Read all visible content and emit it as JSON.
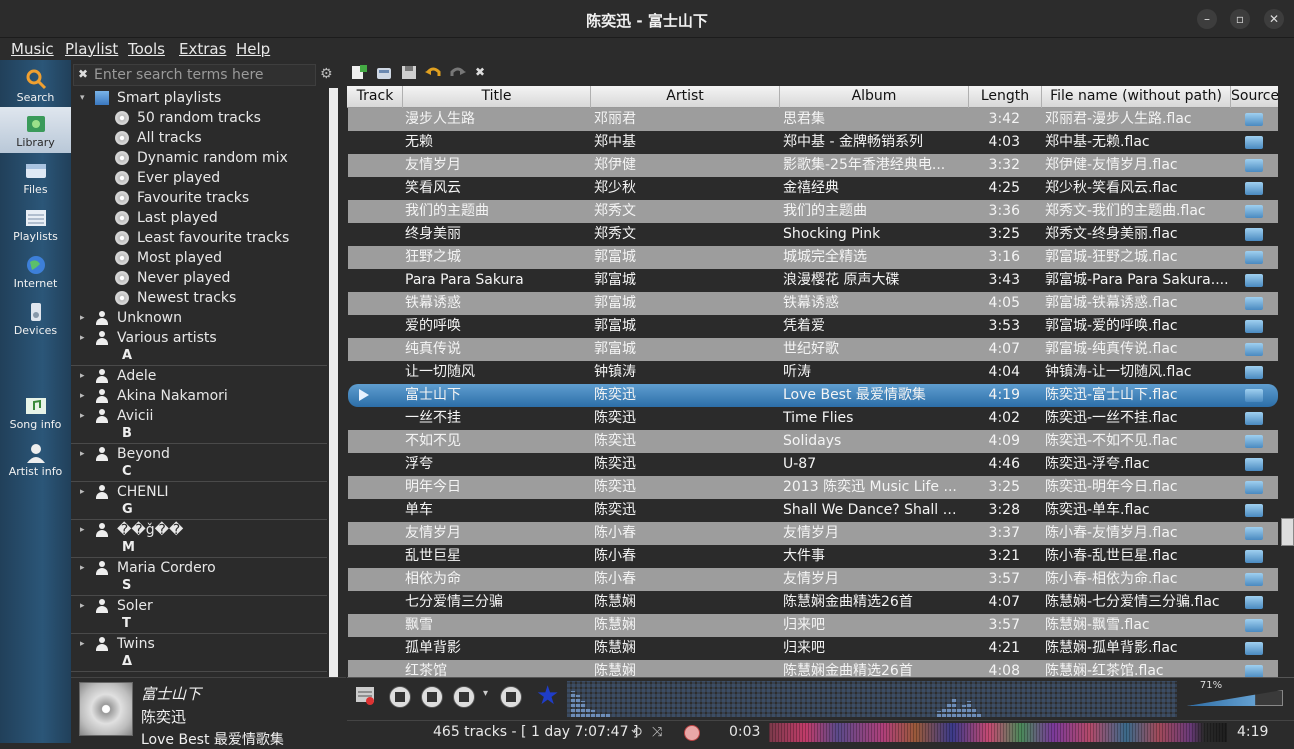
{
  "window": {
    "title": "陈奕迅 - 富士山下"
  },
  "menu": [
    "Music",
    "Playlist",
    "Tools",
    "Extras",
    "Help"
  ],
  "tabs": [
    {
      "label": "Search",
      "icon": "search-icon"
    },
    {
      "label": "Library",
      "icon": "library-icon",
      "active": true
    },
    {
      "label": "Files",
      "icon": "files-icon"
    },
    {
      "label": "Playlists",
      "icon": "playlists-icon"
    },
    {
      "label": "Internet",
      "icon": "internet-icon"
    },
    {
      "label": "Devices",
      "icon": "devices-icon"
    },
    {
      "label": "Song info",
      "icon": "song-info-icon"
    },
    {
      "label": "Artist info",
      "icon": "artist-info-icon"
    }
  ],
  "library": {
    "search_placeholder": "Enter search terms here",
    "smart_playlists_label": "Smart playlists",
    "smart_playlists": [
      "50 random tracks",
      "All tracks",
      "Dynamic random mix",
      "Ever played",
      "Favourite tracks",
      "Last played",
      "Least favourite tracks",
      "Most played",
      "Never played",
      "Newest tracks"
    ],
    "artists_top": [
      "Unknown",
      "Various artists"
    ],
    "groups": [
      {
        "divider": "A",
        "artists": [
          "Adele",
          "Akina Nakamori",
          "Avicii"
        ]
      },
      {
        "divider": "B",
        "artists": [
          "Beyond"
        ]
      },
      {
        "divider": "C",
        "artists": [
          "CHENLI"
        ]
      },
      {
        "divider": "G",
        "artists": [
          "��ǧ��"
        ]
      },
      {
        "divider": "M",
        "artists": [
          "Maria Cordero"
        ]
      },
      {
        "divider": "S",
        "artists": [
          "Soler"
        ]
      },
      {
        "divider": "T",
        "artists": [
          "Twins"
        ]
      },
      {
        "divider": "Δ",
        "artists": []
      }
    ]
  },
  "now_playing": {
    "title": "富士山下",
    "artist": "陈奕迅",
    "album": "Love Best 最爱情歌集"
  },
  "playlist": {
    "columns": [
      "Track",
      "Title",
      "Artist",
      "Album",
      "Length",
      "File name (without path)",
      "Source"
    ],
    "selected_index": 12,
    "rows": [
      [
        "漫步人生路",
        "邓丽君",
        "思君集",
        "3:42",
        "邓丽君-漫步人生路.flac"
      ],
      [
        "无赖",
        "郑中基",
        "郑中基 - 金牌畅销系列",
        "4:03",
        "郑中基-无赖.flac"
      ],
      [
        "友情岁月",
        "郑伊健",
        "影歌集-25年香港经典电...",
        "3:32",
        "郑伊健-友情岁月.flac"
      ],
      [
        "笑看风云",
        "郑少秋",
        "金禧经典",
        "4:25",
        "郑少秋-笑看风云.flac"
      ],
      [
        "我们的主题曲",
        "郑秀文",
        "我们的主题曲",
        "3:36",
        "郑秀文-我们的主题曲.flac"
      ],
      [
        "终身美丽",
        "郑秀文",
        "Shocking Pink",
        "3:25",
        "郑秀文-终身美丽.flac"
      ],
      [
        "狂野之城",
        "郭富城",
        "城城完全精选",
        "3:16",
        "郭富城-狂野之城.flac"
      ],
      [
        "Para Para Sakura",
        "郭富城",
        "浪漫樱花 原声大碟",
        "3:43",
        "郭富城-Para Para Sakura...."
      ],
      [
        "铁幕诱惑",
        "郭富城",
        "铁幕诱惑",
        "4:05",
        "郭富城-铁幕诱惑.flac"
      ],
      [
        "爱的呼唤",
        "郭富城",
        "凭着爱",
        "3:53",
        "郭富城-爱的呼唤.flac"
      ],
      [
        "纯真传说",
        "郭富城",
        "世纪好歌",
        "4:07",
        "郭富城-纯真传说.flac"
      ],
      [
        "让一切随风",
        "钟镇涛",
        "听涛",
        "4:04",
        "钟镇涛-让一切随风.flac"
      ],
      [
        "富士山下",
        "陈奕迅",
        "Love Best 最爱情歌集",
        "4:19",
        "陈奕迅-富士山下.flac"
      ],
      [
        "一丝不挂",
        "陈奕迅",
        "Time Flies",
        "4:02",
        "陈奕迅-一丝不挂.flac"
      ],
      [
        "不如不见",
        "陈奕迅",
        "Solidays",
        "4:09",
        "陈奕迅-不如不见.flac"
      ],
      [
        "浮夸",
        "陈奕迅",
        "U-87",
        "4:46",
        "陈奕迅-浮夸.flac"
      ],
      [
        "明年今日",
        "陈奕迅",
        "2013 陈奕迅 Music Life ...",
        "3:25",
        "陈奕迅-明年今日.flac"
      ],
      [
        "单车",
        "陈奕迅",
        "Shall We Dance? Shall W...",
        "3:28",
        "陈奕迅-单车.flac"
      ],
      [
        "友情岁月",
        "陈小春",
        "友情岁月",
        "3:37",
        "陈小春-友情岁月.flac"
      ],
      [
        "乱世巨星",
        "陈小春",
        "大件事",
        "3:21",
        "陈小春-乱世巨星.flac"
      ],
      [
        "相依为命",
        "陈小春",
        "友情岁月",
        "3:57",
        "陈小春-相依为命.flac"
      ],
      [
        "七分爱情三分骗",
        "陈慧娴",
        "陈慧娴金曲精选26首",
        "4:07",
        "陈慧娴-七分爱情三分骗.flac"
      ],
      [
        "飘雪",
        "陈慧娴",
        "归来吧",
        "3:57",
        "陈慧娴-飘雪.flac"
      ],
      [
        "孤单背影",
        "陈慧娴",
        "归来吧",
        "4:21",
        "陈慧娴-孤单背影.flac"
      ],
      [
        "红茶馆",
        "陈慧娴",
        "陈慧娴金曲精选26首",
        "4:08",
        "陈慧娴-红茶馆.flac"
      ]
    ]
  },
  "player": {
    "volume": "71%",
    "volume_fraction": 0.71,
    "status": "465 tracks - [ 1 day 7:07:47 ]",
    "elapsed": "0:03",
    "total": "4:19"
  },
  "colors": {
    "accent": "#2c6ea8",
    "row_alt": "#9d9d9d",
    "star": "#1f3dc8"
  }
}
